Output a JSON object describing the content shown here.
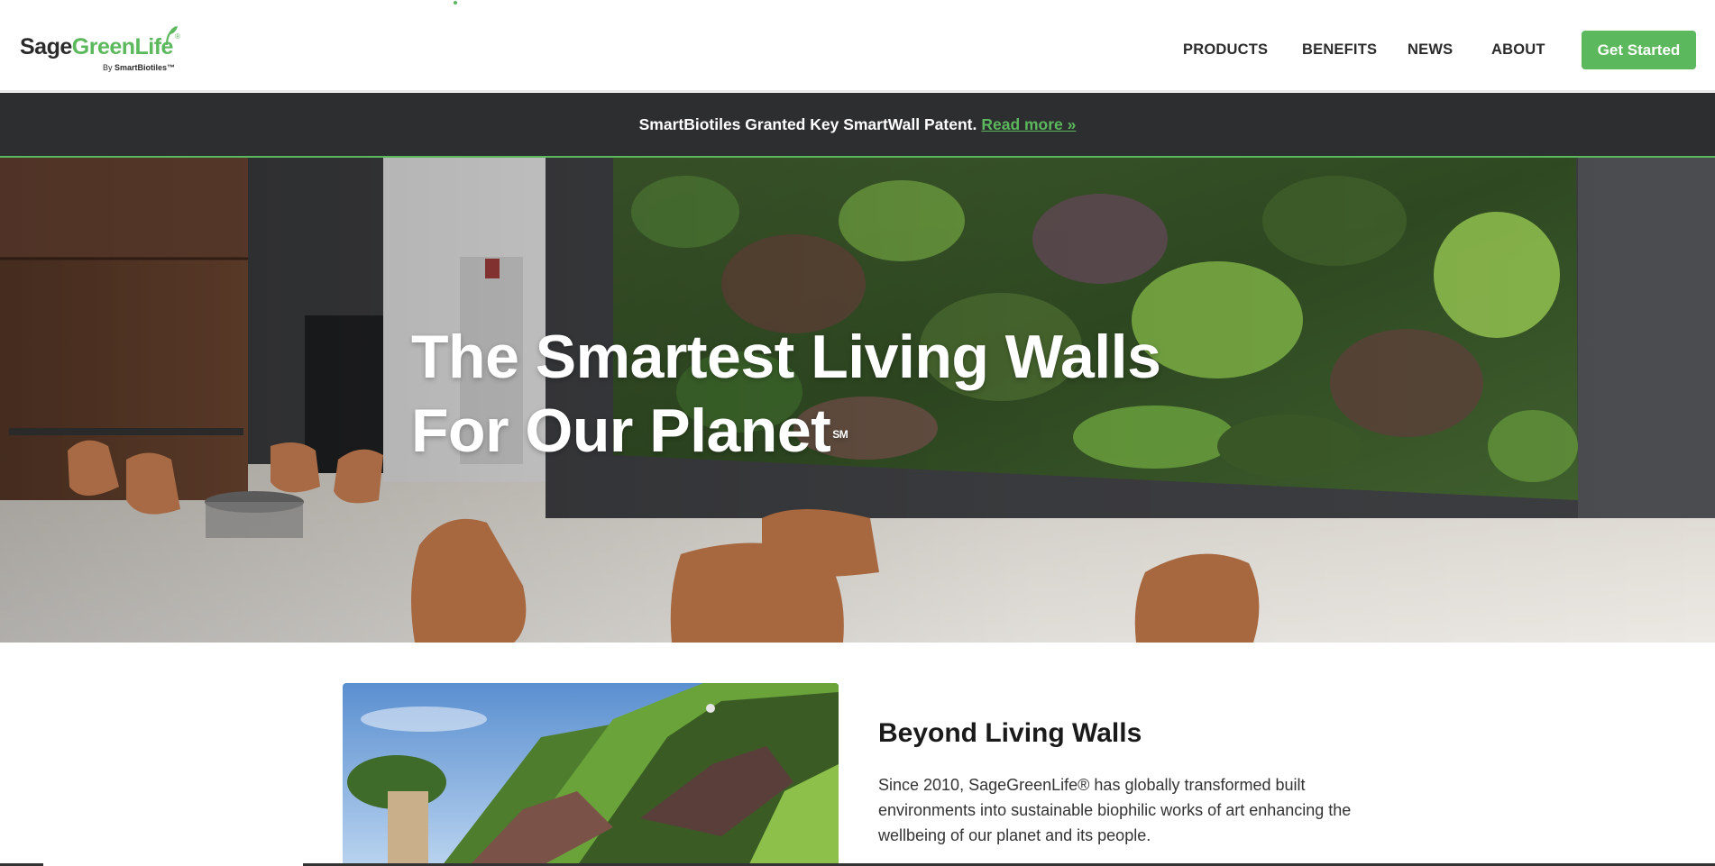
{
  "header": {
    "logo": {
      "word_dark": "Sage",
      "word_green": "GreenLife",
      "registered": "®",
      "sub_prefix": "By ",
      "sub_brand": "SmartBiotiles™"
    },
    "nav": [
      {
        "label": "PRODUCTS"
      },
      {
        "label": "BENEFITS"
      },
      {
        "label": "NEWS"
      },
      {
        "label": "ABOUT"
      }
    ],
    "cta_label": "Get Started"
  },
  "announcement": {
    "text": "SmartBiotiles Granted Key SmartWall Patent.",
    "link_label": "Read more »"
  },
  "hero": {
    "title_line1": "The Smartest Living Walls",
    "title_line2": "For Our Planet",
    "title_mark": "SM"
  },
  "intro": {
    "heading": "Beyond Living Walls",
    "body": "Since 2010, SageGreenLife® has globally transformed built environments into sustainable biophilic works of art enhancing the wellbeing of our planet and its people."
  },
  "colors": {
    "brand_green": "#5cb85c",
    "dark_bar": "#2d2e30",
    "text_dark": "#2b2b2b"
  },
  "icons": {
    "logo_leaf": "leaf-icon"
  }
}
